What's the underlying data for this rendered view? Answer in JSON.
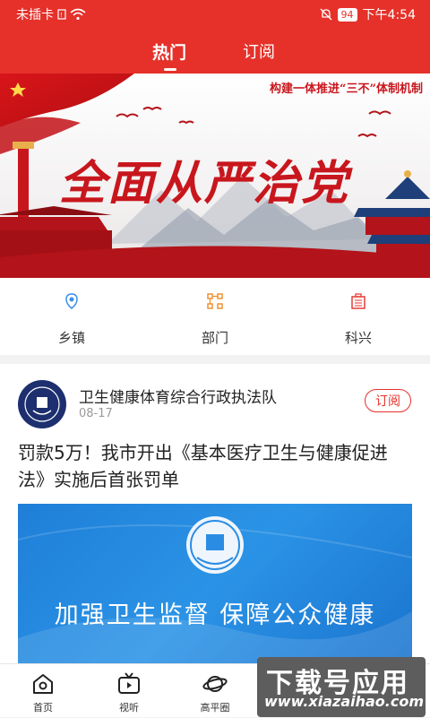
{
  "status_bar": {
    "carrier": "未插卡",
    "battery": "94",
    "time": "下午4:54"
  },
  "top_tabs": [
    {
      "label": "热门",
      "active": true
    },
    {
      "label": "订阅",
      "active": false
    }
  ],
  "banner": {
    "slogan": "构建一体推进“三不”体制机制",
    "title": "全面从严治党"
  },
  "quick_links": [
    {
      "label": "乡镇",
      "icon": "location-pin-icon"
    },
    {
      "label": "部门",
      "icon": "org-chart-icon"
    },
    {
      "label": "科兴",
      "icon": "building-icon"
    }
  ],
  "feed_item": {
    "source_name": "卫生健康体育综合行政执法队",
    "date": "08-17",
    "subscribe_label": "订阅",
    "headline": "罚款5万！我市开出《基本医疗卫生与健康促进法》实施后首张罚单",
    "image_caption": "加强卫生监督  保障公众健康"
  },
  "bottom_nav": [
    {
      "label": "首页",
      "icon": "home-icon"
    },
    {
      "label": "视听",
      "icon": "tv-icon"
    },
    {
      "label": "高平圈",
      "icon": "planet-icon"
    },
    {
      "label": "",
      "icon": ""
    },
    {
      "label": "",
      "icon": ""
    }
  ],
  "watermark": {
    "line1": "下载号应用",
    "line2": "www.xiazaihao.com"
  },
  "colors": {
    "brand_red": "#e5312a",
    "image_blue": "#2b8ce3"
  }
}
